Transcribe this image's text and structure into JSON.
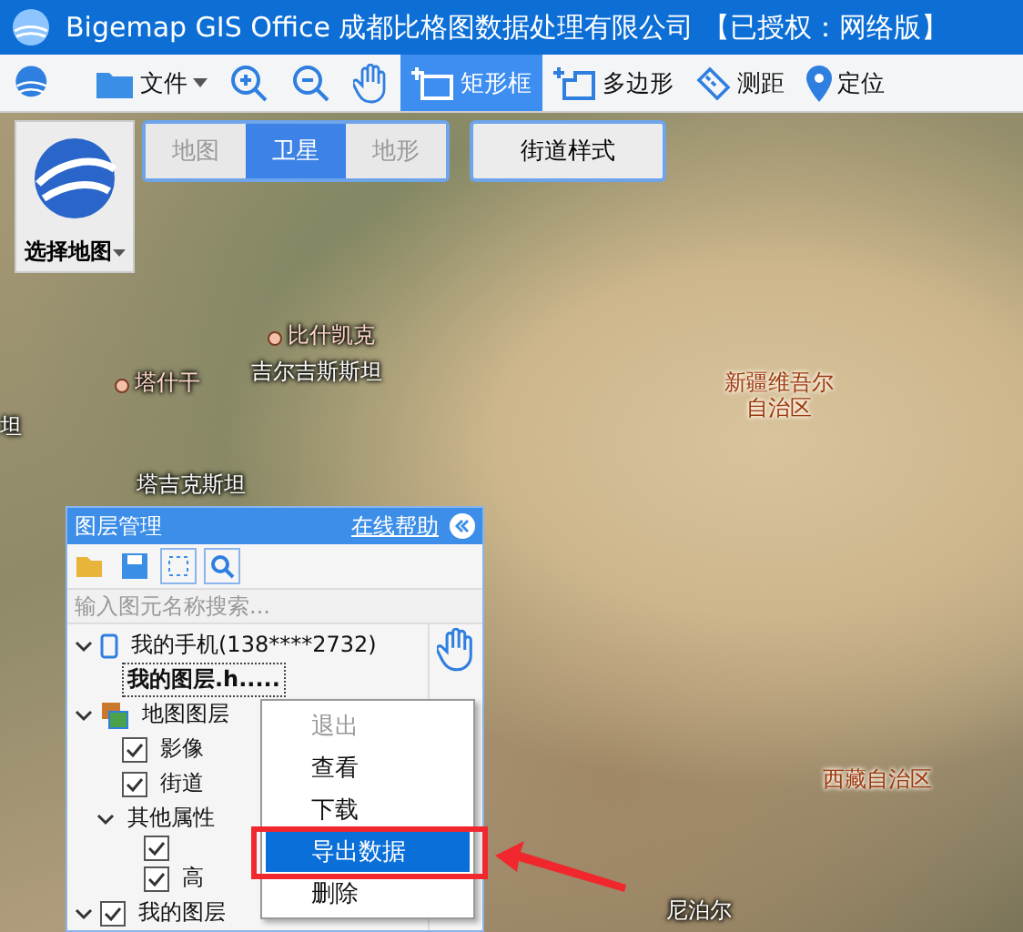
{
  "window": {
    "title": "Bigemap GIS Office 成都比格图数据处理有限公司 【已授权：网络版】"
  },
  "toolbar": [
    {
      "kind": "file",
      "label": "文件",
      "selected": false
    },
    {
      "kind": "zoom-in",
      "selected": false
    },
    {
      "kind": "zoom-out",
      "selected": false
    },
    {
      "kind": "pan",
      "selected": false
    },
    {
      "kind": "rect",
      "label": "矩形框",
      "selected": true
    },
    {
      "kind": "polygon",
      "label": "多边形",
      "selected": false
    },
    {
      "kind": "measure",
      "label": "测距",
      "selected": false
    },
    {
      "kind": "locate",
      "label": "定位",
      "selected": false
    }
  ],
  "map_selector": {
    "label": "选择地图"
  },
  "map_types": [
    {
      "label": "地图",
      "selected": false
    },
    {
      "label": "卫星",
      "selected": true
    },
    {
      "label": "地形",
      "selected": false
    }
  ],
  "street_style": {
    "label": "街道样式"
  },
  "map_labels": [
    {
      "lines": [
        "比什凯克"
      ],
      "kind": "city"
    },
    {
      "lines": [
        "塔什干"
      ],
      "kind": "city"
    },
    {
      "lines": [
        "吉尔吉斯斯坦"
      ],
      "kind": "country"
    },
    {
      "lines": [
        "坦"
      ],
      "kind": "country"
    },
    {
      "lines": [
        "新疆维吾尔",
        "自治区"
      ],
      "kind": "region"
    },
    {
      "lines": [
        "塔吉克斯坦"
      ],
      "kind": "country"
    },
    {
      "lines": [
        "西藏自治区"
      ],
      "kind": "region"
    },
    {
      "lines": [
        "尼泊尔"
      ],
      "kind": "country"
    }
  ],
  "layer_panel": {
    "title": "图层管理",
    "help_link": "在线帮助",
    "search": {
      "placeholder": "输入图元名称搜索..."
    },
    "tree": [
      {
        "kind": "phone",
        "label": "我的手机(138****2732)",
        "expanded": true,
        "children": [
          {
            "kind": "layer",
            "label": "我的图层.h.....",
            "selected": true
          }
        ]
      },
      {
        "kind": "maps",
        "label": "地图图层",
        "expanded": true,
        "children": [
          {
            "kind": "check",
            "label": "影像",
            "checked": true
          },
          {
            "kind": "check",
            "label": "街道",
            "checked": true
          },
          {
            "kind": "group",
            "label": "其他属性",
            "expanded": true,
            "children": [
              {
                "kind": "check",
                "checked": true
              },
              {
                "kind": "check",
                "label": "高",
                "checked": true
              }
            ]
          }
        ]
      },
      {
        "kind": "check",
        "label": "我的图层",
        "checked": true,
        "expanded": true
      }
    ]
  },
  "context_menu": [
    {
      "label": "退出",
      "disabled": true,
      "selected": false
    },
    {
      "label": "查看",
      "disabled": false,
      "selected": false
    },
    {
      "label": "下载",
      "disabled": false,
      "selected": false
    },
    {
      "label": "导出数据",
      "disabled": false,
      "selected": true
    },
    {
      "label": "删除",
      "disabled": false,
      "selected": false
    }
  ]
}
